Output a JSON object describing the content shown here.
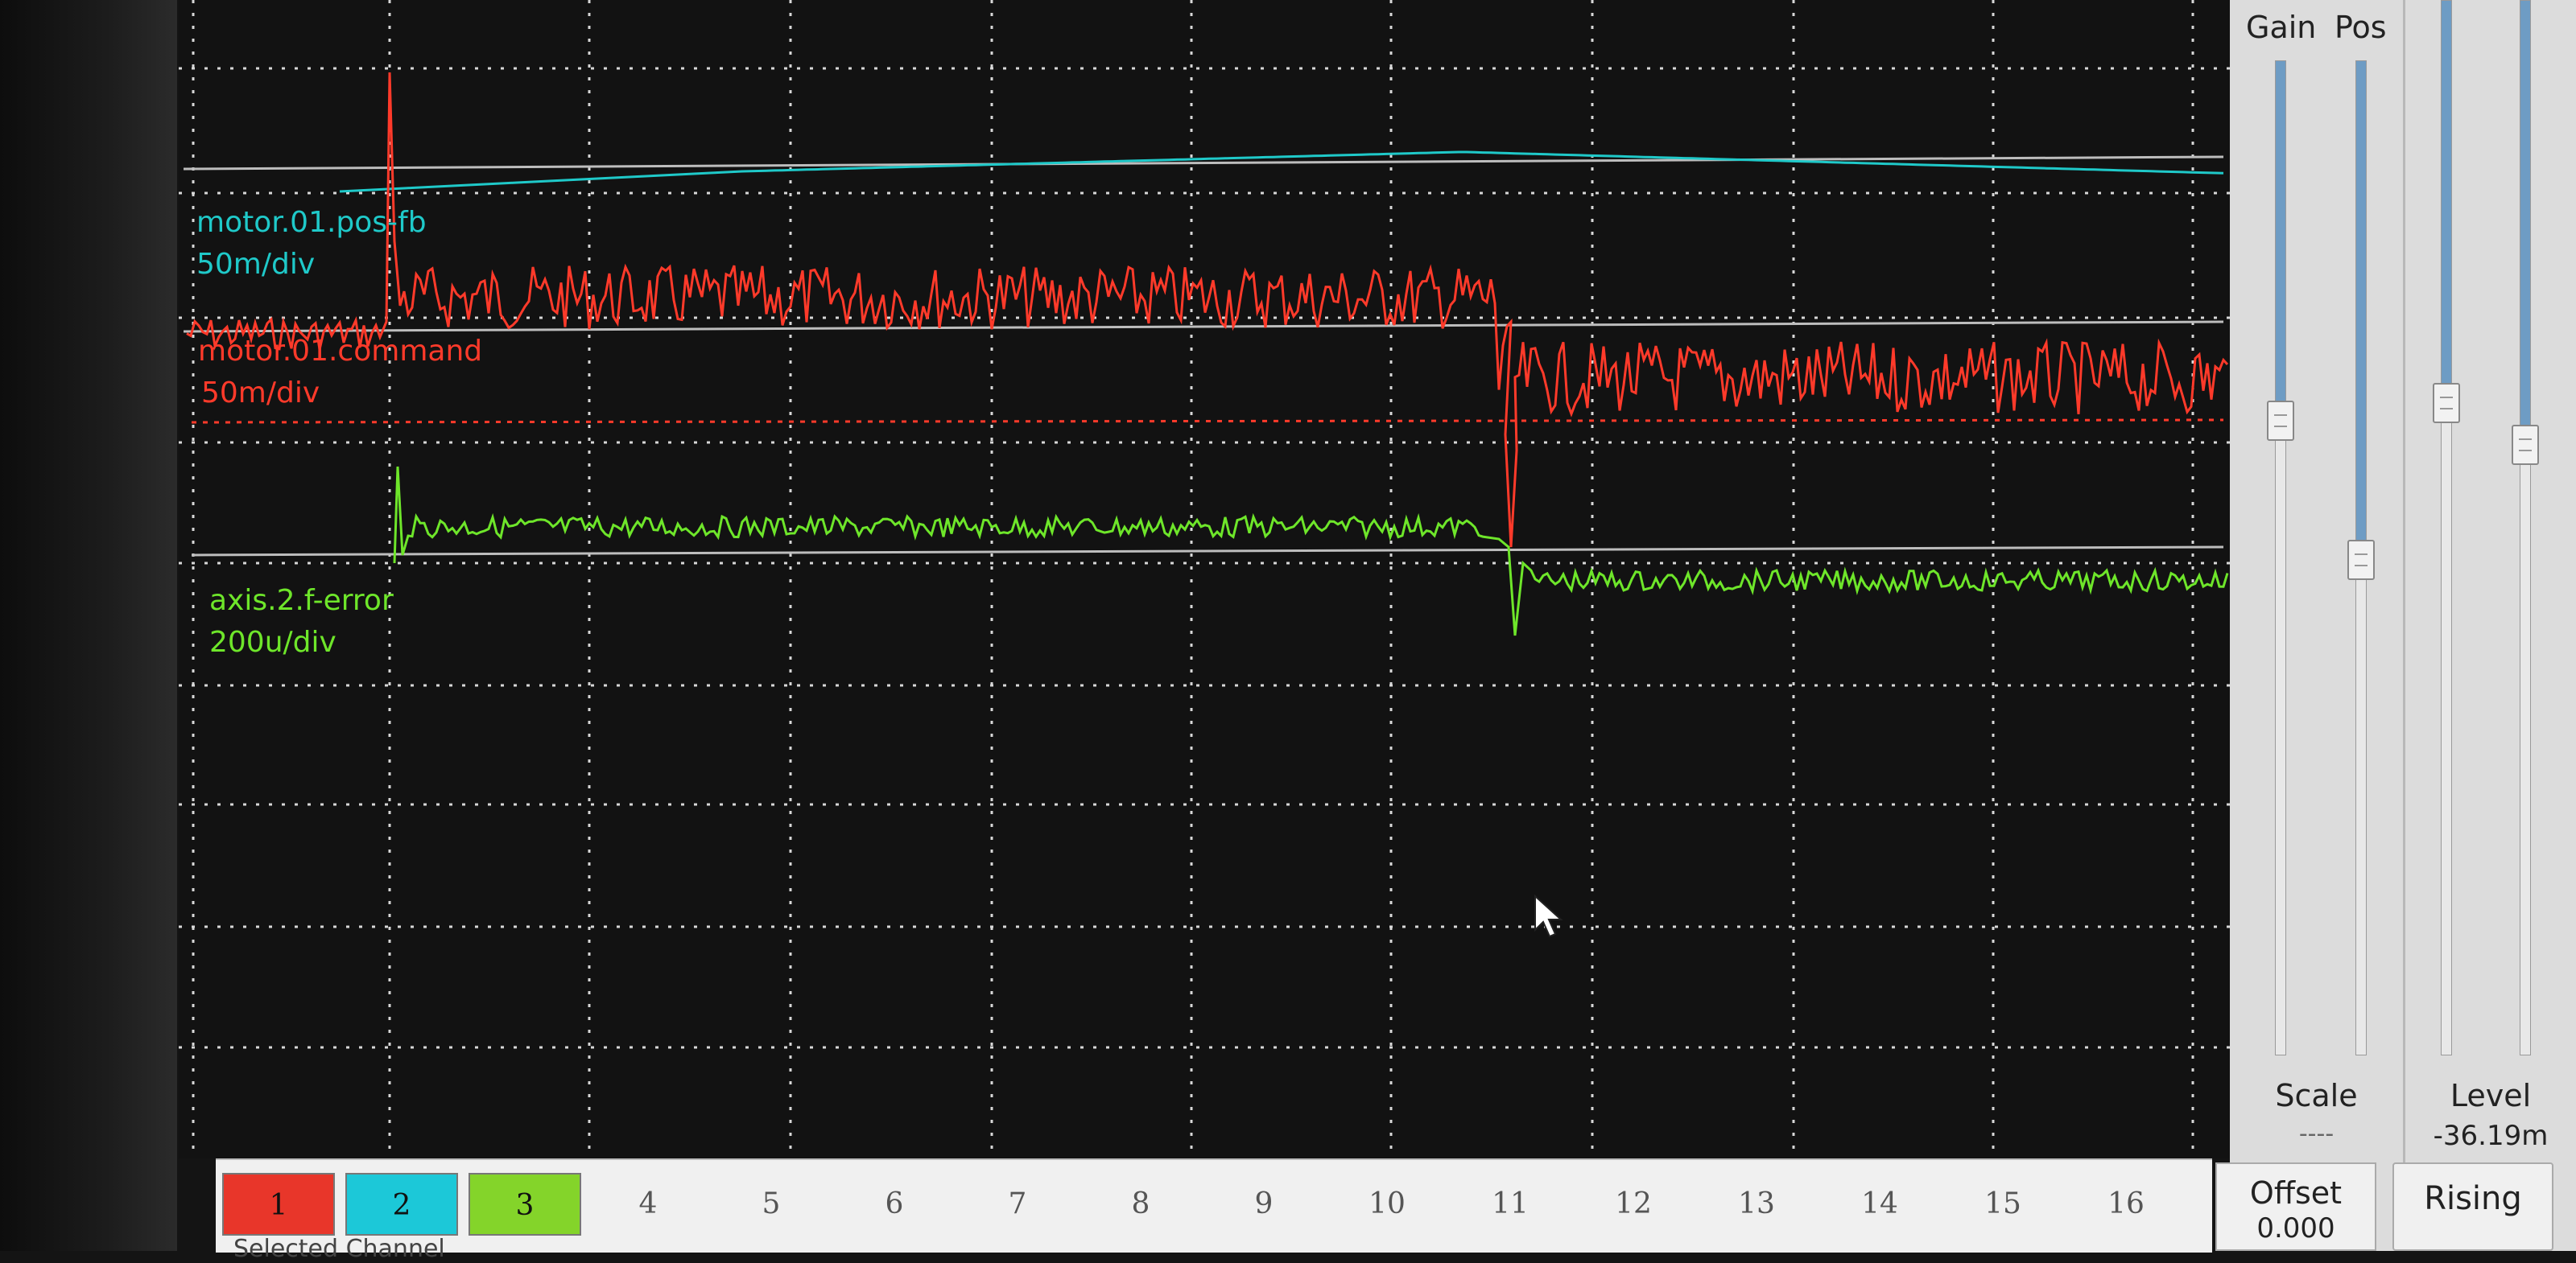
{
  "traces": [
    {
      "id": 1,
      "signal": "motor.01.command",
      "scale": "50m/div",
      "color": "#ff3a2a"
    },
    {
      "id": 2,
      "signal": "motor.01.pos-fb",
      "scale": "50m/div",
      "color": "#1fc9c9"
    },
    {
      "id": 3,
      "signal": "axis.2.f-error",
      "scale": "200u/div",
      "color": "#6ee62a"
    }
  ],
  "vertical_panel": {
    "gain_label": "Gain",
    "pos_label": "Pos",
    "scale_label": "Scale",
    "scale_value": "----",
    "offset_label": "Offset",
    "offset_value": "0.000",
    "gain_level": 0.36,
    "pos_level": 0.5
  },
  "trigger_panel": {
    "level_label": "Level",
    "level_value": "-36.19m",
    "edge_button": "Rising",
    "level_slider": 0.38,
    "pos_slider": 0.42
  },
  "channel_buttons": [
    "1",
    "2",
    "3",
    "4",
    "5",
    "6",
    "7",
    "8",
    "9",
    "10",
    "11",
    "12",
    "13",
    "14",
    "15",
    "16"
  ],
  "channel_colors": {
    "1": "#e8362a",
    "2": "#1cc8d8",
    "3": "#84d42a"
  },
  "footer": {
    "selected_channel_label": "Selected Channel"
  },
  "colors": {
    "screen_bg": "#121212",
    "grid": "#d8d8d8",
    "panel_bg": "#dcdcdc"
  }
}
